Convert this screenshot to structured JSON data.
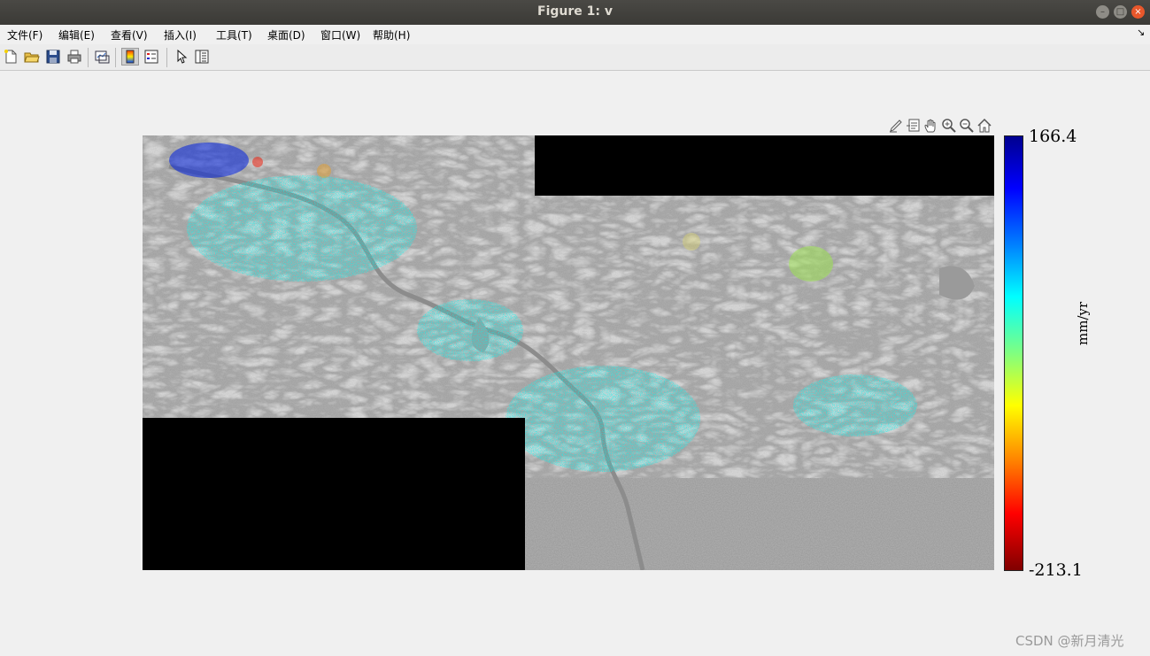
{
  "window": {
    "title": "Figure 1: v"
  },
  "menu": [
    {
      "label": "文件(F)"
    },
    {
      "label": "编辑(E)"
    },
    {
      "label": "查看(V)"
    },
    {
      "label": "插入(I)"
    },
    {
      "label": "工具(T)"
    },
    {
      "label": "桌面(D)"
    },
    {
      "label": "窗口(W)"
    },
    {
      "label": "帮助(H)"
    }
  ],
  "toolbar": {
    "icons": [
      "new-figure-icon",
      "open-file-icon",
      "save-icon",
      "print-icon",
      "link-plot-icon",
      "insert-colorbar-icon",
      "insert-legend-icon",
      "edit-plot-arrow-icon",
      "property-inspector-icon"
    ]
  },
  "axes_toolbar": {
    "icons": [
      "brush-icon",
      "data-tips-icon",
      "pan-hand-icon",
      "zoom-in-icon",
      "zoom-out-icon",
      "home-restore-icon"
    ]
  },
  "colorbar": {
    "max_label": "166.4",
    "min_label": "-213.1",
    "unit_label": "mm/yr",
    "colormap": "jet (reversed)"
  },
  "watermark": "CSDN @新月清光"
}
